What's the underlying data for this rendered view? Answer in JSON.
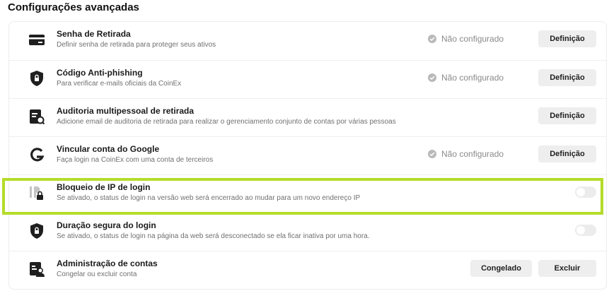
{
  "section": {
    "title": "Configurações avançadas"
  },
  "colors": {
    "highlight": "#b5dc2a",
    "button_bg": "#eeeeee",
    "status_check": "#b9b9b9"
  },
  "rows": [
    {
      "icon": "card-icon",
      "title": "Senha de Retirada",
      "description": "Definir senha de retirada para proteger seus ativos",
      "status": "Não configurado",
      "button": "Definição"
    },
    {
      "icon": "shield-icon",
      "title": "Código Anti-phishing",
      "description": "Para verificar e-mails oficiais da CoinEx",
      "status": "Não configurado",
      "button": "Definição"
    },
    {
      "icon": "audit-document-icon",
      "title": "Auditoria multipessoal de retirada",
      "description": "Adicione email de auditoria de retirada para realizar o gerenciamento conjunto de contas por várias pessoas",
      "button": "Definição"
    },
    {
      "icon": "google-icon",
      "title": "Vincular conta do Google",
      "description": "Faça login na CoinEx com uma conta de terceiros",
      "status": "Não configurado",
      "button": "Definição"
    },
    {
      "icon": "ip-lock-icon",
      "title": "Bloqueio de IP de login",
      "description": "Se ativado, o status de login na versão web será encerrado ao mudar para um novo endereço IP",
      "toggle": "off"
    },
    {
      "icon": "shield-icon",
      "title": "Duração segura do login",
      "description": "Se ativado, o status de login na página da web será desconectado se ela ficar inativa por uma hora.",
      "toggle": "off"
    },
    {
      "icon": "account-admin-icon",
      "title": "Administração de contas",
      "description": "Congelar ou excluir conta",
      "buttons": [
        "Congelado",
        "Excluir"
      ]
    }
  ]
}
